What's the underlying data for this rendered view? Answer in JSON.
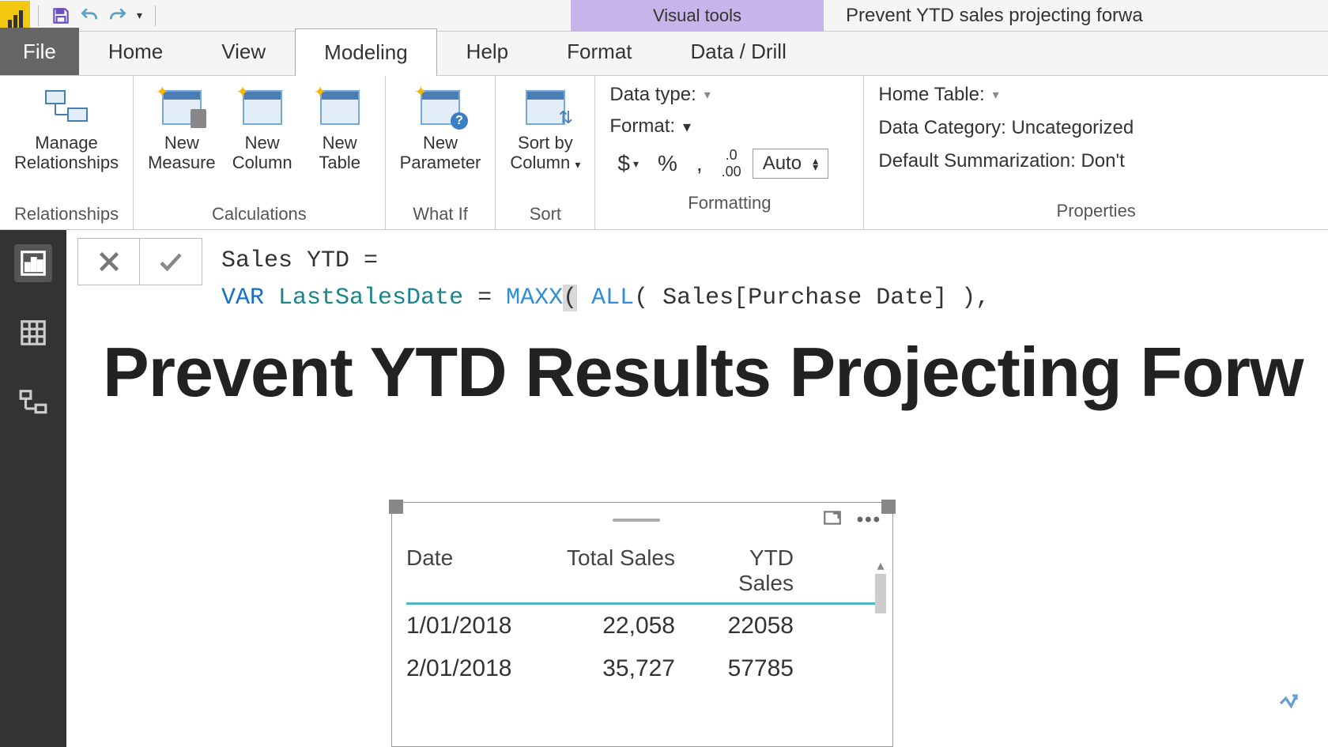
{
  "app": {
    "contextual_tab": "Visual tools",
    "title": "Prevent YTD sales projecting forwa"
  },
  "tabs": {
    "file": "File",
    "home": "Home",
    "view": "View",
    "modeling": "Modeling",
    "help": "Help",
    "format": "Format",
    "data_drill": "Data / Drill"
  },
  "ribbon": {
    "relationships": {
      "manage": "Manage\nRelationships",
      "group": "Relationships"
    },
    "calculations": {
      "measure": "New\nMeasure",
      "column": "New\nColumn",
      "table": "New\nTable",
      "group": "Calculations"
    },
    "whatif": {
      "parameter": "New\nParameter",
      "group": "What If"
    },
    "sort": {
      "sortby": "Sort by\nColumn",
      "group": "Sort"
    },
    "formatting": {
      "datatype_label": "Data type:",
      "format_label": "Format:",
      "currency": "$",
      "percent": "%",
      "comma": ",",
      "decimals_icon": ".00",
      "auto": "Auto",
      "group": "Formatting"
    },
    "properties": {
      "home_table": "Home Table:",
      "data_category": "Data Category: Uncategorized",
      "default_summ": "Default Summarization: Don't",
      "group": "Properties"
    }
  },
  "formula": {
    "line1_name": "Sales YTD",
    "line1_eq": " = ",
    "line2_var": "VAR",
    "line2_name": "LastSalesDate",
    "line2_eq": " = ",
    "line2_maxx": "MAXX",
    "line2_paren1": "(",
    "line2_all": "ALL",
    "line2_inner": "( Sales[Purchase Date] ),",
    "line2_highlight": "Sales[Purchase Date] )"
  },
  "report": {
    "title": "Prevent YTD Results Projecting Forw"
  },
  "table": {
    "headers": {
      "date": "Date",
      "total": "Total Sales",
      "ytd": "YTD Sales"
    },
    "rows": [
      {
        "date": "1/01/2018",
        "total": "22,058",
        "ytd": "22058"
      },
      {
        "date": "2/01/2018",
        "total": "35,727",
        "ytd": "57785"
      }
    ]
  }
}
